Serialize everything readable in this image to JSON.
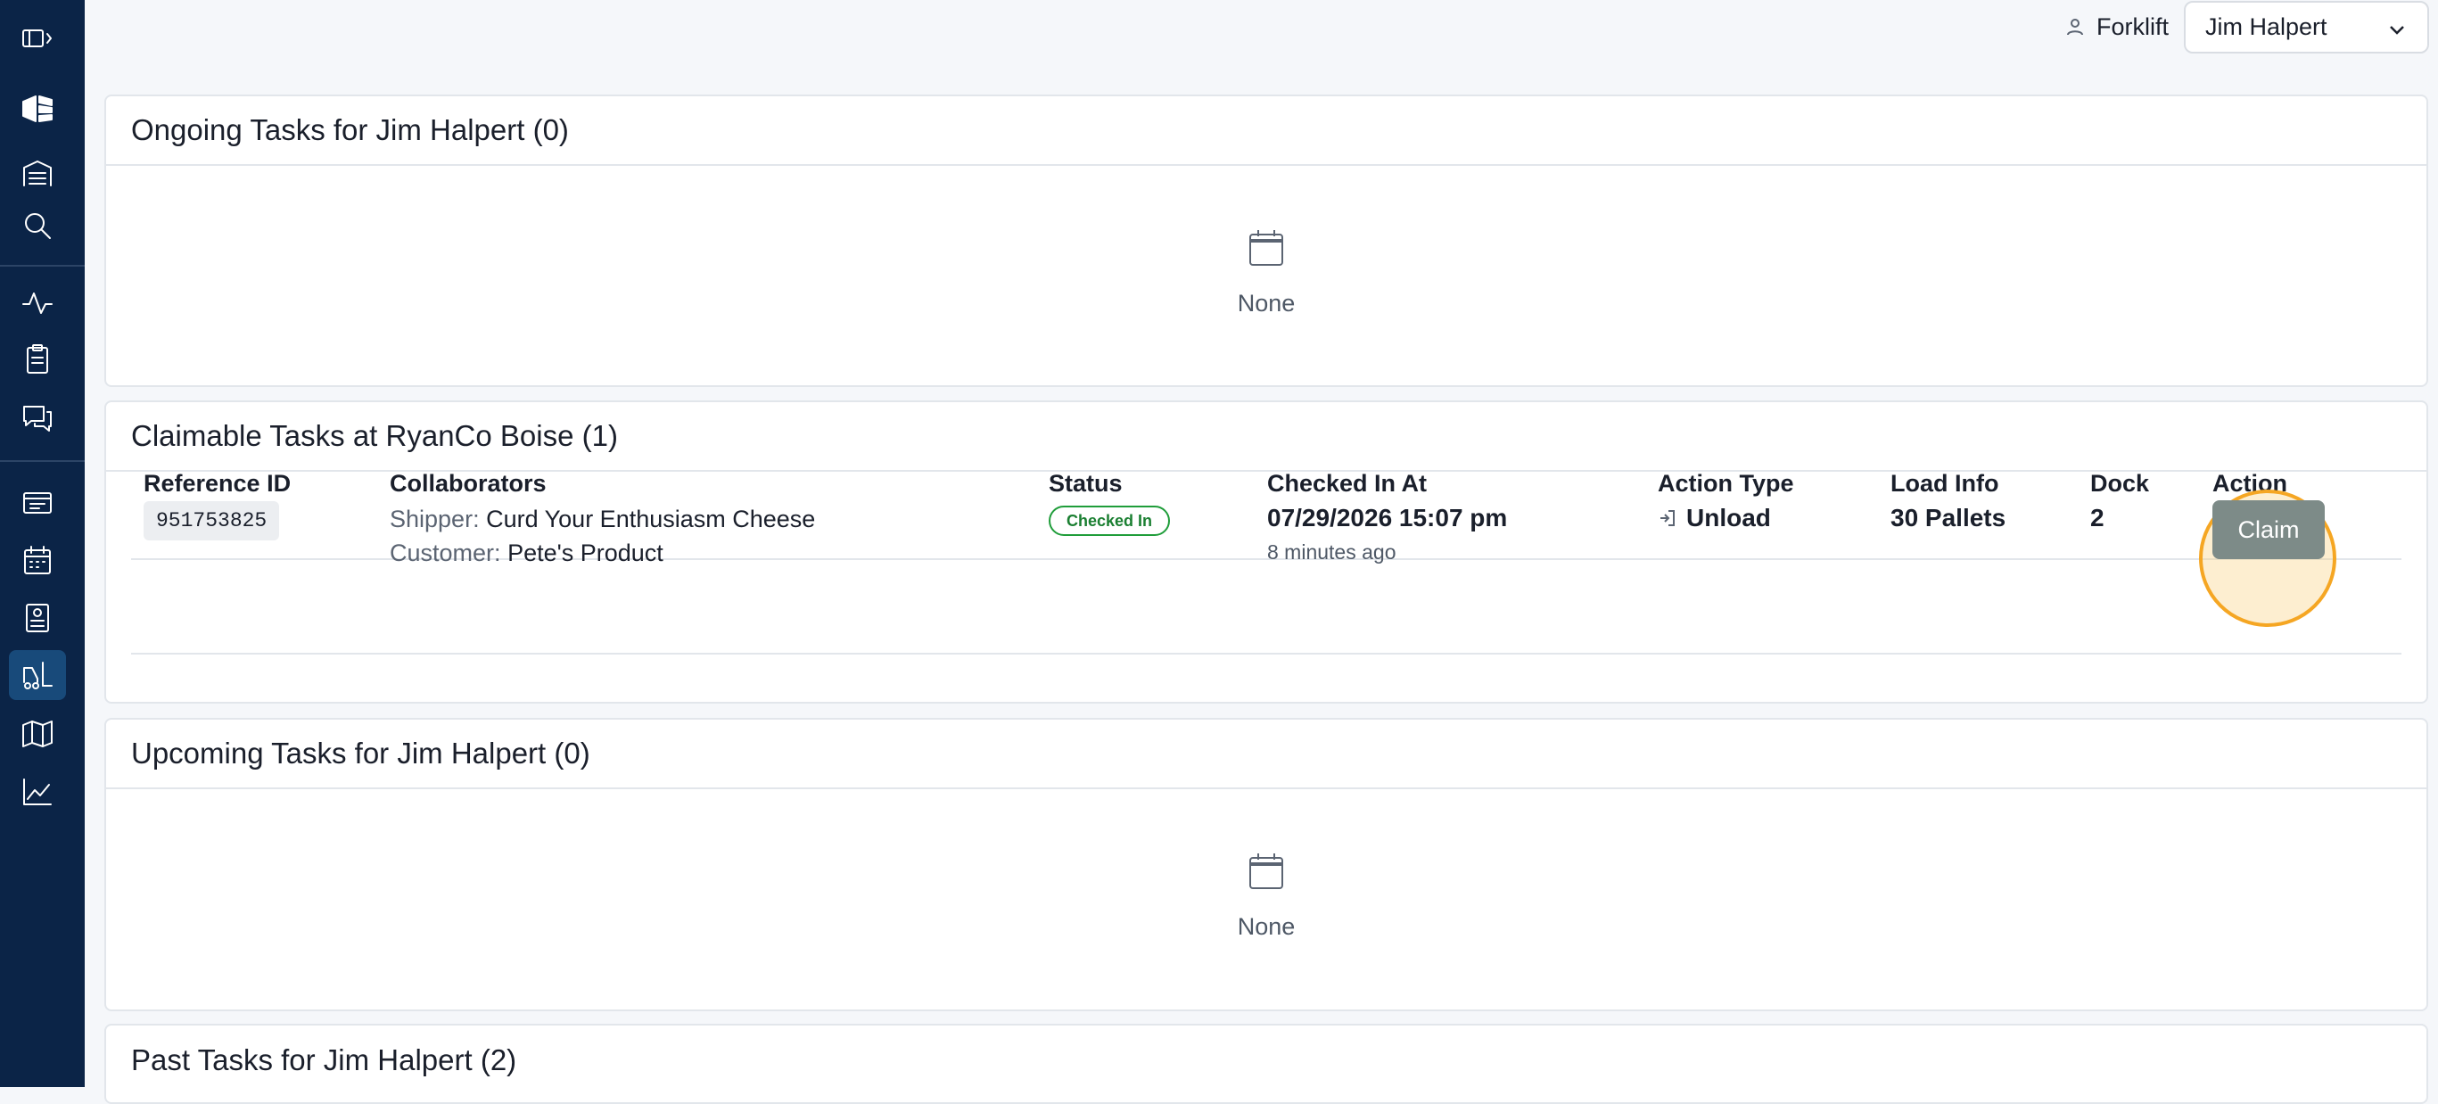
{
  "topbar": {
    "role_label": "Forklift",
    "user_selected": "Jim Halpert"
  },
  "sidebar": {
    "items": [
      {
        "icon": "sidebar-toggle-icon"
      },
      {
        "icon": "logo-icon"
      },
      {
        "icon": "warehouse-icon"
      },
      {
        "icon": "search-icon"
      },
      {
        "icon": "activity-icon"
      },
      {
        "icon": "clipboard-icon"
      },
      {
        "icon": "messages-icon"
      },
      {
        "icon": "receipt-icon"
      },
      {
        "icon": "calendar-icon"
      },
      {
        "icon": "dock-icon"
      },
      {
        "icon": "forklift-icon",
        "active": true
      },
      {
        "icon": "map-icon"
      },
      {
        "icon": "analytics-icon"
      }
    ]
  },
  "ongoing": {
    "title": "Ongoing Tasks for Jim Halpert (0)",
    "empty_text": "None"
  },
  "claimable": {
    "title": "Claimable Tasks at RyanCo Boise (1)",
    "headers": [
      "Reference ID",
      "Collaborators",
      "Status",
      "Checked In At",
      "Action Type",
      "Load Info",
      "Dock",
      "Action"
    ],
    "rows": [
      {
        "reference_id": "951753825",
        "shipper_label": "Shipper:",
        "shipper": "Curd Your Enthusiasm Cheese",
        "customer_label": "Customer:",
        "customer": "Pete's Product",
        "status": "Checked In",
        "checked_in_at": "07/29/2026 15:07 pm",
        "checked_in_ago": "8 minutes ago",
        "action_type": "Unload",
        "load_info": "30 Pallets",
        "dock": "2",
        "action_label": "Claim"
      }
    ]
  },
  "upcoming": {
    "title": "Upcoming Tasks for Jim Halpert (0)",
    "empty_text": "None"
  },
  "past": {
    "title": "Past Tasks for Jim Halpert (2)"
  },
  "colors": {
    "sidebar_bg": "#0b2447",
    "status_green": "#1f9d3a",
    "highlight_orange": "#f5a623",
    "claim_button": "#7d8b88"
  }
}
